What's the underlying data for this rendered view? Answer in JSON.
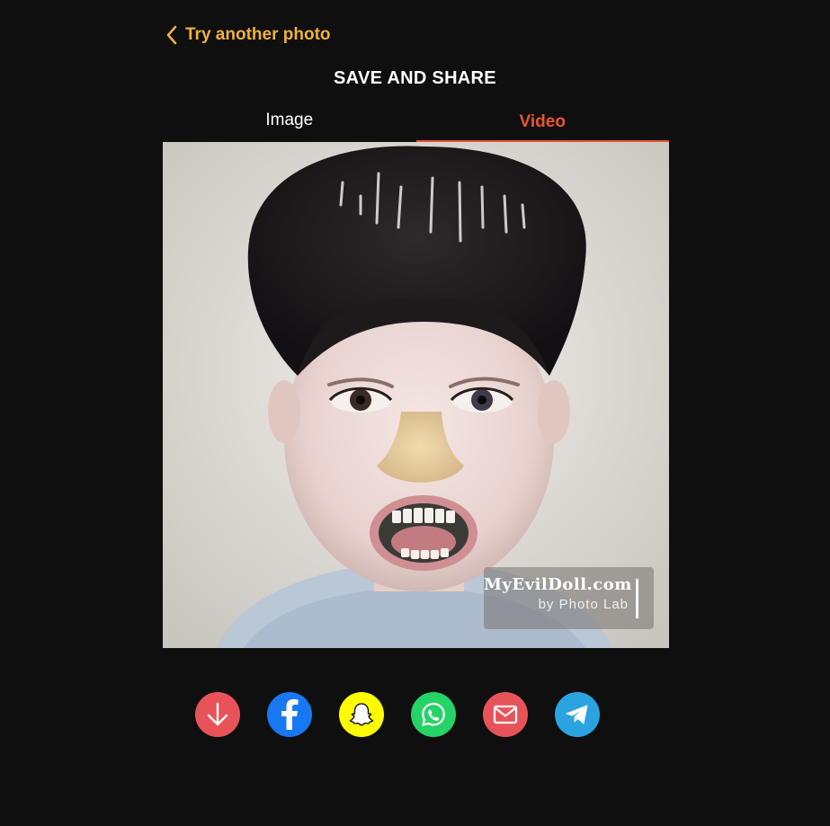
{
  "header": {
    "back_label": "Try another photo",
    "title": "SAVE AND SHARE"
  },
  "tabs": [
    {
      "label": "Image",
      "active": false
    },
    {
      "label": "Video",
      "active": true
    }
  ],
  "watermark": {
    "brand": "MyEvilDoll.com",
    "subtitle": "by Photo Lab"
  },
  "share_buttons": [
    {
      "name": "download",
      "icon": "download-arrow-icon",
      "color": "#e8535a"
    },
    {
      "name": "facebook",
      "icon": "facebook-icon",
      "color": "#1877f2"
    },
    {
      "name": "snapchat",
      "icon": "snapchat-ghost-icon",
      "color": "#fffc00"
    },
    {
      "name": "whatsapp",
      "icon": "whatsapp-icon",
      "color": "#25d366"
    },
    {
      "name": "email",
      "icon": "mail-icon",
      "color": "#e8535a"
    },
    {
      "name": "telegram",
      "icon": "telegram-icon",
      "color": "#2aa3e0"
    }
  ],
  "colors": {
    "background": "#0f0f0f",
    "accent_back": "#f0b03a",
    "accent_tab": "#e8552e"
  }
}
